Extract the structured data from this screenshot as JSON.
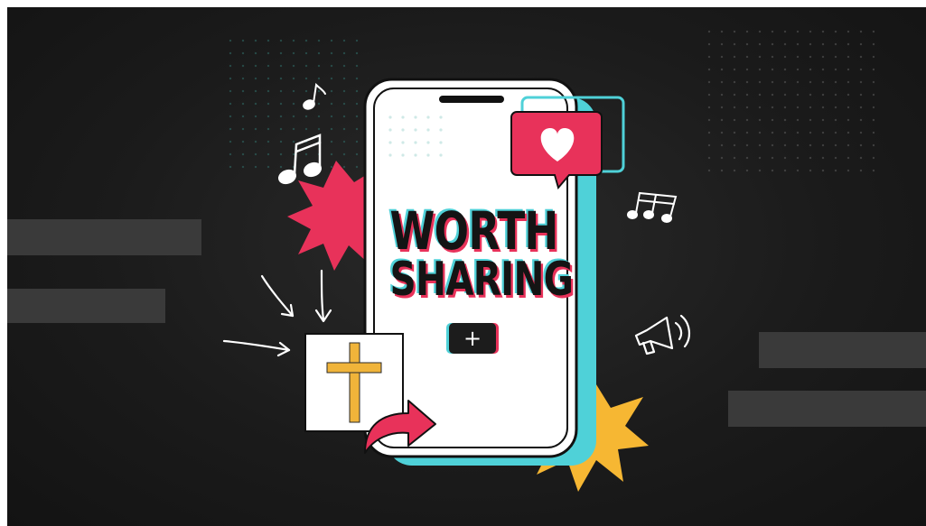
{
  "headline": {
    "line1": "WORTH",
    "line2": "SHARING"
  },
  "create_button": {
    "symbol": "+"
  },
  "icons": [
    "music-note-icon",
    "music-notes-icon",
    "heart-icon",
    "cross-icon",
    "share-arrow-icon",
    "megaphone-icon"
  ],
  "colors": {
    "background": "#1b1b1b",
    "accent_red": "#e8325a",
    "accent_cyan": "#4fd1d8",
    "accent_yellow": "#f6b733",
    "cross_gold": "#f0b43a"
  }
}
